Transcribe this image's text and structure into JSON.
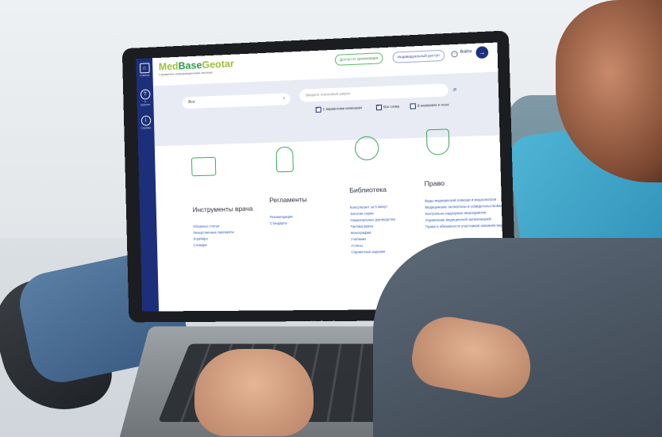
{
  "app": {
    "logo_med": "Med",
    "logo_base": "Base",
    "logo_geotar": "Geotar",
    "subtitle": "Справочно-информационная система"
  },
  "header": {
    "org_access": "Доступ от организации",
    "personal_access": "Индивидуальный доступ",
    "login": "Войти"
  },
  "sidebar": {
    "items": [
      {
        "label": "Главная",
        "icon": "home-icon"
      },
      {
        "label": "О проекте",
        "icon": "help-icon"
      },
      {
        "label": "Справка",
        "icon": "info-icon"
      }
    ]
  },
  "search": {
    "scope_value": "Все",
    "placeholder": "Введите поисковый запрос",
    "options": [
      {
        "label": "С вариантами написания",
        "checked": true
      },
      {
        "label": "Все слова",
        "checked": true
      },
      {
        "label": "В названиях и тегах",
        "checked": false
      }
    ]
  },
  "categories": [
    {
      "title": "Инструменты врача",
      "links": [
        "Обзорные статьи",
        "Лекарственные препараты",
        "ЛорИнфо",
        "Словари"
      ]
    },
    {
      "title": "Регламенты",
      "links": [
        "Рекомендации",
        "Стандарты"
      ]
    },
    {
      "title": "Библиотека",
      "links": [
        "Консультант за 5 минут",
        "Золотая серия",
        "Национальные руководства",
        "Тактика врача",
        "Монографии",
        "Учебники",
        "Атласы",
        "Справочные издания"
      ]
    },
    {
      "title": "Право",
      "links": [
        "Виды медицинской помощи и медосмотров",
        "Медицинские экспертизы и освидетельствования",
        "Контрольно-надзорные мероприятия",
        "Управление медицинской организацией",
        "Права и обязанности участников оказания медпомощи"
      ]
    }
  ],
  "device_label": "MacBook Pro",
  "colors": {
    "brand_blue": "#1c2f7a",
    "brand_green": "#3aa856",
    "link_blue": "#2e56b8"
  }
}
